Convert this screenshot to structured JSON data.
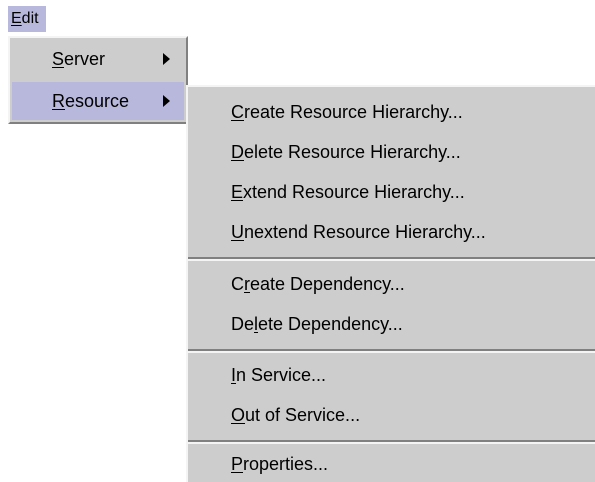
{
  "menubar": {
    "edit": {
      "pre": "",
      "ul": "E",
      "post": "dit"
    }
  },
  "edit_menu": {
    "server": {
      "pre": "",
      "ul": "S",
      "post": "erver"
    },
    "resource": {
      "pre": "",
      "ul": "R",
      "post": "esource"
    }
  },
  "resource_submenu": {
    "create_hierarchy": {
      "pre": "",
      "ul": "C",
      "post": "reate Resource Hierarchy..."
    },
    "delete_hierarchy": {
      "pre": "",
      "ul": "D",
      "post": "elete Resource Hierarchy..."
    },
    "extend_hierarchy": {
      "pre": "",
      "ul": "E",
      "post": "xtend Resource Hierarchy..."
    },
    "unextend_hierarchy": {
      "pre": "",
      "ul": "U",
      "post": "nextend Resource Hierarchy..."
    },
    "create_dependency": {
      "pre": "C",
      "ul": "r",
      "post": "eate Dependency..."
    },
    "delete_dependency": {
      "pre": "De",
      "ul": "l",
      "post": "ete Dependency..."
    },
    "in_service": {
      "pre": "",
      "ul": "I",
      "post": "n Service..."
    },
    "out_of_service": {
      "pre": "",
      "ul": "O",
      "post": "ut of Service..."
    },
    "properties": {
      "pre": "",
      "ul": "P",
      "post": "roperties..."
    }
  },
  "colors": {
    "highlight": "#b8b8dc",
    "menu_background": "#cdcdcd"
  }
}
